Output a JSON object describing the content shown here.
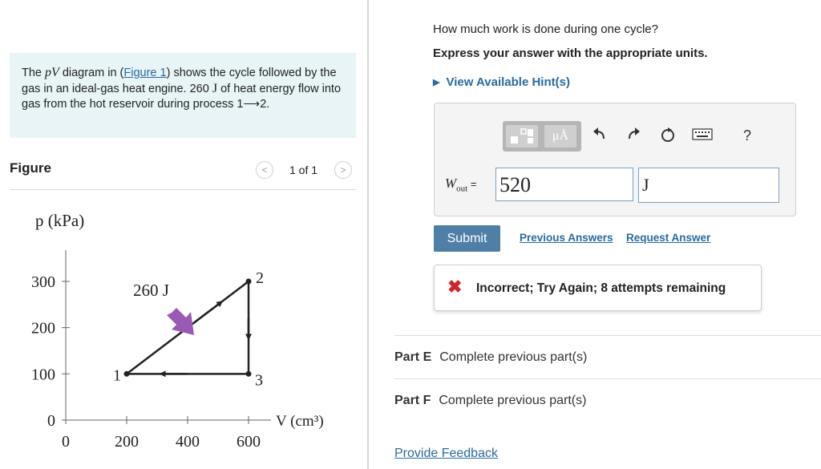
{
  "problem": {
    "text_before": "The ",
    "var_pv": "pV",
    "text_diagram_in": " diagram in (",
    "figure_link": "Figure 1",
    "text_shows": ") shows the cycle followed by the gas in an ideal-gas heat engine. 260 ",
    "unit_J": "J",
    "text_after": " of heat energy flow into gas from the hot reservoir during process 1⟶2."
  },
  "figure": {
    "title": "Figure",
    "prev_icon": "chevron-left-icon",
    "next_icon": "chevron-right-icon",
    "pager": "1 of 1"
  },
  "graph": {
    "y_label": "p (kPa)",
    "x_label": "V (cm³)",
    "y_ticks": [
      "300",
      "200",
      "100",
      "0"
    ],
    "x_ticks": [
      "0",
      "200",
      "400",
      "600"
    ],
    "heat_label": "260 J",
    "points": [
      {
        "label": "1",
        "V": 200,
        "p": 100
      },
      {
        "label": "2",
        "V": 600,
        "p": 300
      },
      {
        "label": "3",
        "V": 600,
        "p": 100
      }
    ],
    "arrow_color": "#9b59b6"
  },
  "question": {
    "text": "How much work is done during one cycle?",
    "instruction": "Express your answer with the appropriate units.",
    "hint": "View Available Hint(s)"
  },
  "answer": {
    "label_var": "W",
    "label_sub": "out",
    "label_eq": " =",
    "value": "520",
    "unit": "J",
    "toolbar": {
      "mu_a": "μÅ",
      "icons": [
        "templates-icon",
        "units-icon",
        "undo-icon",
        "redo-icon",
        "reset-icon",
        "keyboard-icon",
        "help-icon"
      ],
      "help": "?"
    }
  },
  "actions": {
    "submit": "Submit",
    "previous": "Previous Answers",
    "request": "Request Answer"
  },
  "feedback": {
    "icon": "x-icon",
    "text": "Incorrect; Try Again; 8 attempts remaining",
    "color": "#d1232a"
  },
  "parts": [
    {
      "label": "Part E",
      "text": "Complete previous part(s)"
    },
    {
      "label": "Part F",
      "text": "Complete previous part(s)"
    }
  ],
  "footer": {
    "provide_feedback": "Provide Feedback"
  }
}
